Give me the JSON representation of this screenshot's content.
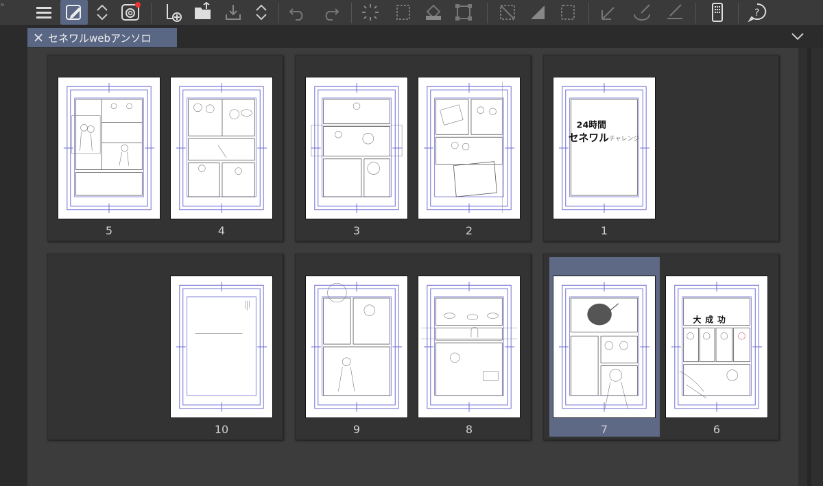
{
  "document_tab": {
    "title": "セネワルwebアンソロ"
  },
  "toolbar": {
    "icons": [
      "menu-icon",
      "edit-page-icon",
      "up-down-icon",
      "cloud-sync-icon",
      "add-page-icon",
      "open-folder-icon",
      "export-icon",
      "up-down-icon",
      "undo-icon",
      "redo-icon",
      "loading-icon",
      "select-area-icon",
      "fill-icon",
      "transform-icon",
      "ruler-icon",
      "fill-shape-icon",
      "selection-icon",
      "pen-icon",
      "brush-icon",
      "eraser-icon",
      "smartphone-icon",
      "help-icon"
    ]
  },
  "colors": {
    "accent": "#5a6784",
    "panel": "#3c3c3c",
    "guide": "#6c6cd4"
  },
  "pages": {
    "p5": "5",
    "p4": "4",
    "p3": "3",
    "p2": "2",
    "p1": "1",
    "p10": "10",
    "p9": "9",
    "p8": "8",
    "p7": "7",
    "p6": "6"
  },
  "page_text": {
    "p1_line1": "24時間",
    "p1_line2": "セネワル",
    "p1_line3": "チャレンジ",
    "p6_title": "大成功"
  }
}
